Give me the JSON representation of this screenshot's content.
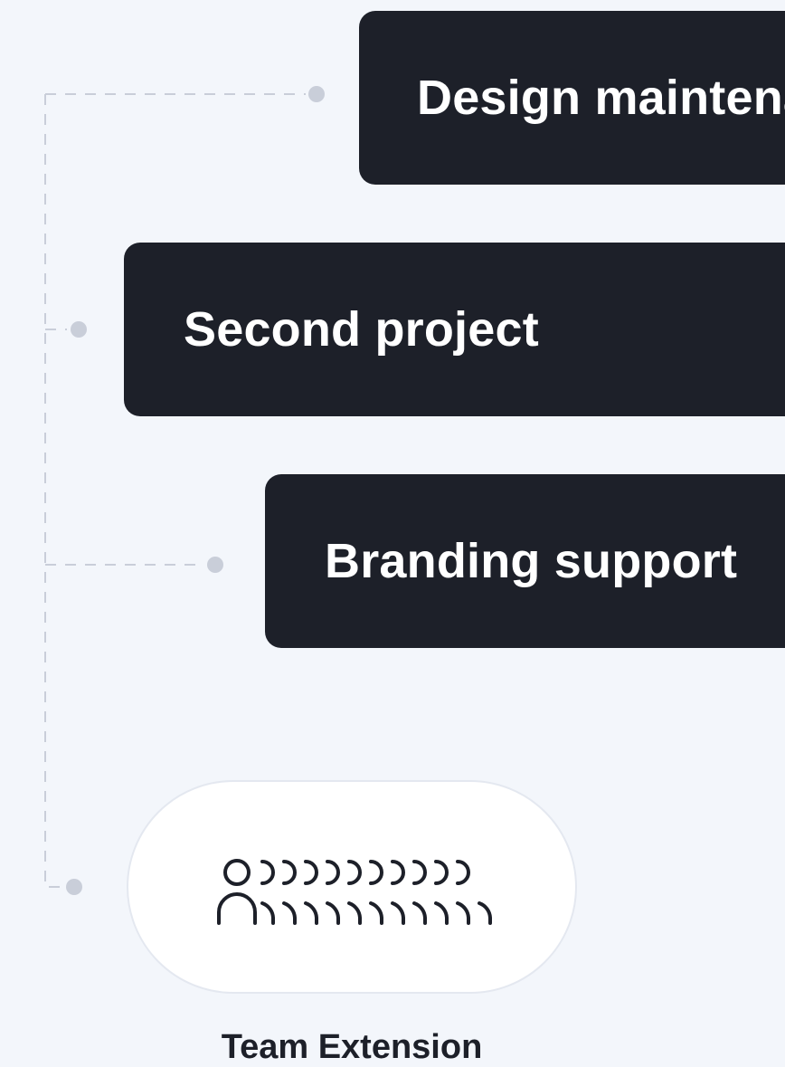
{
  "projects": [
    {
      "label": "Design maintenance"
    },
    {
      "label": "Second project"
    },
    {
      "label": "Branding support"
    }
  ],
  "team": {
    "label": "Team Extension",
    "icon": "team-group-icon"
  },
  "colors": {
    "background": "#f3f6fb",
    "card": "#1d2029",
    "card_text": "#ffffff",
    "connector": "#c9ced9",
    "pill": "#ffffff"
  }
}
